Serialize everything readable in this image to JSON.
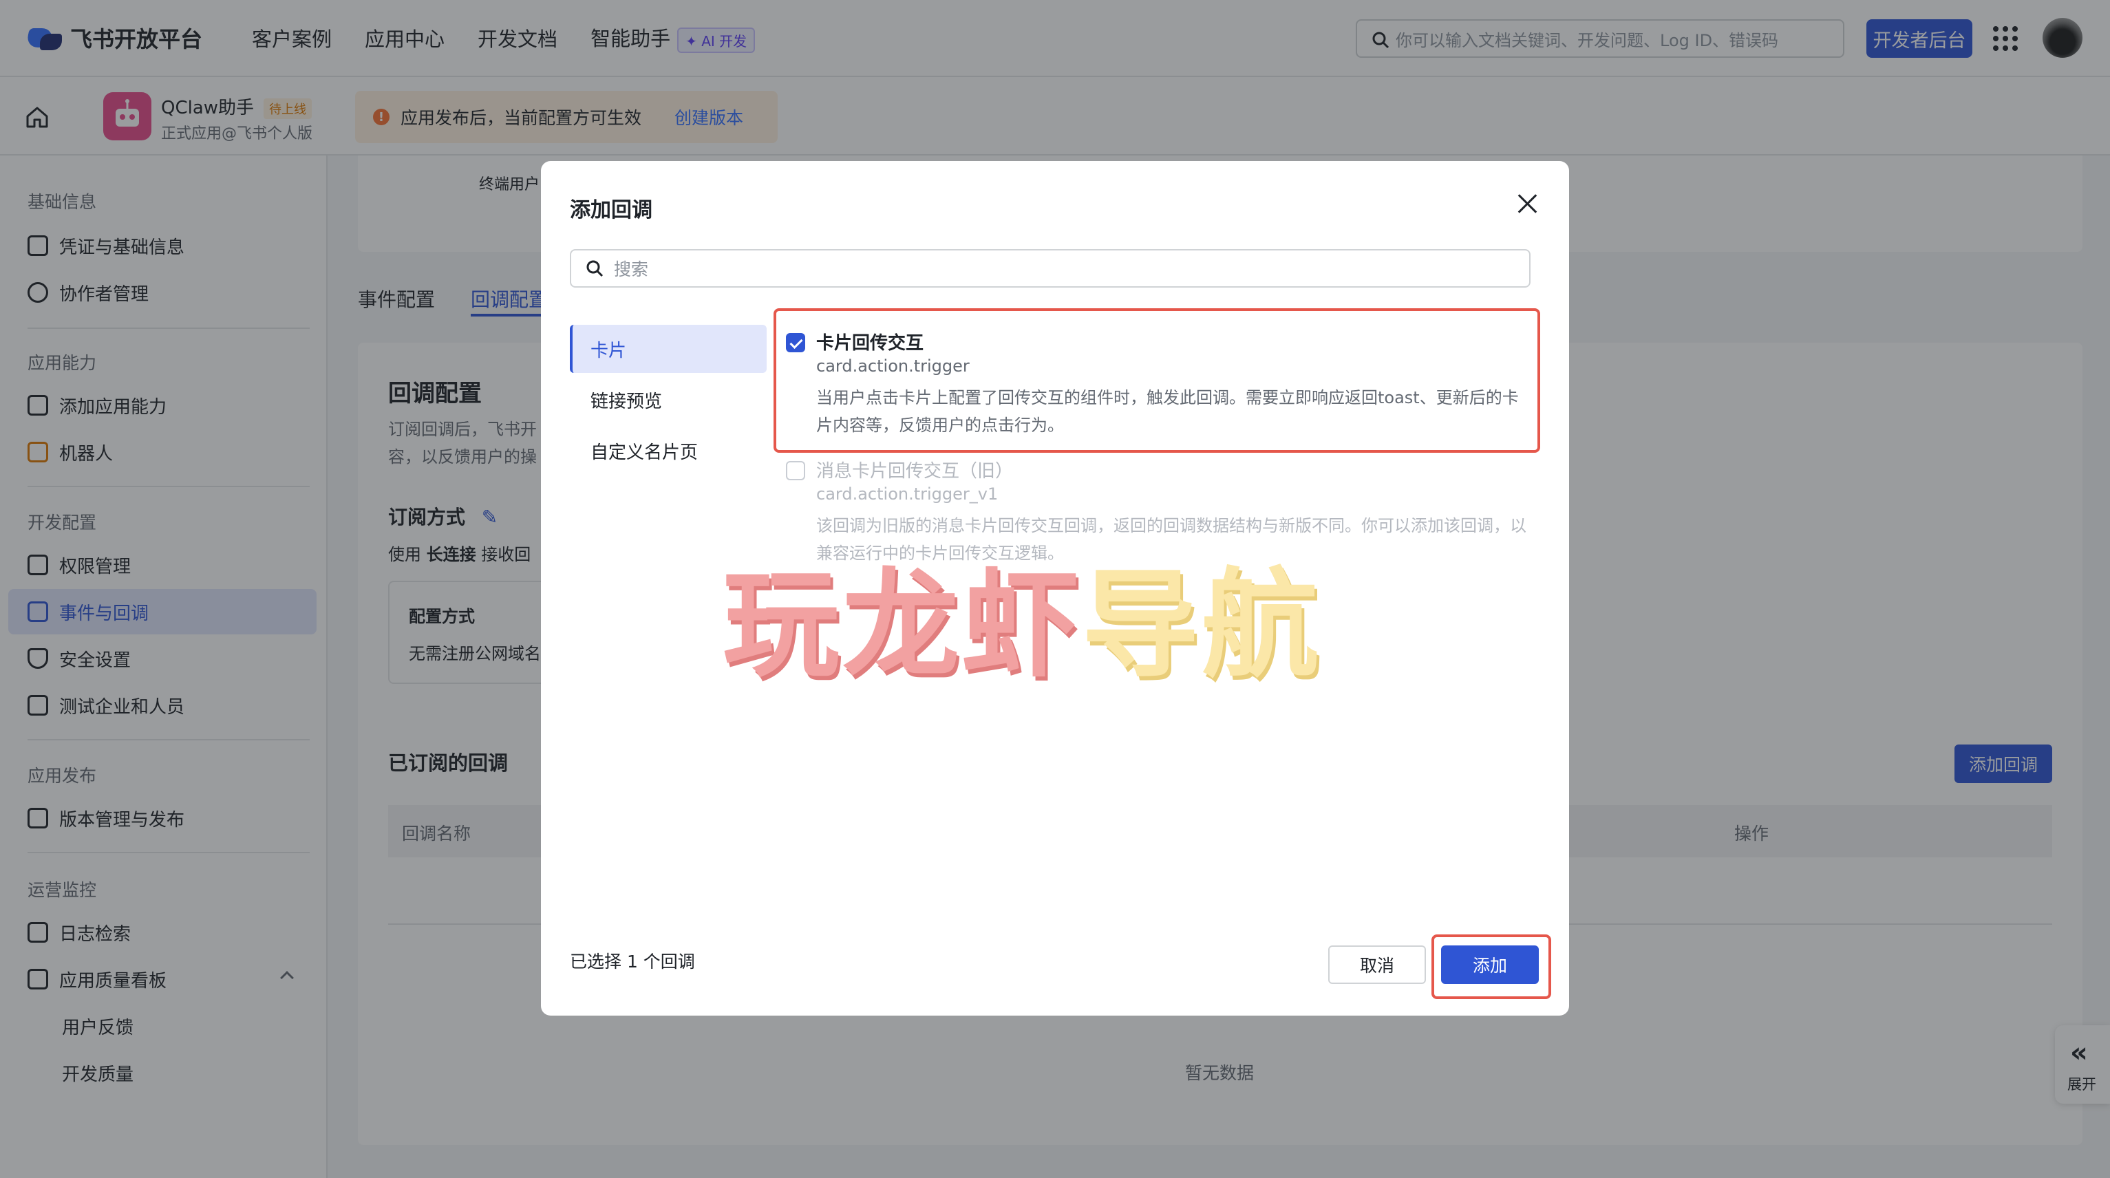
{
  "topbar": {
    "logo_text": "飞书开放平台",
    "nav": [
      "客户案例",
      "应用中心",
      "开发文档",
      "智能助手"
    ],
    "ai_badge": "✦ AI 开发",
    "search_placeholder": "你可以输入文档关键词、开发问题、Log ID、错误码",
    "dev_button": "开发者后台"
  },
  "appbar": {
    "app_name": "QClaw助手",
    "app_status": "待上线",
    "app_sub": "正式应用@飞书个人版",
    "notice_text": "应用发布后，当前配置方可生效",
    "notice_link": "创建版本"
  },
  "sidebar": {
    "groups": [
      "基础信息",
      "应用能力",
      "开发配置",
      "应用发布",
      "运营监控"
    ],
    "items": [
      "凭证与基础信息",
      "协作者管理",
      "添加应用能力",
      "机器人",
      "权限管理",
      "事件与回调",
      "安全设置",
      "测试企业和人员",
      "版本管理与发布",
      "日志检索",
      "应用质量看板",
      "用户反馈",
      "开发质量"
    ]
  },
  "main": {
    "term_user": "终端用户",
    "tabs": [
      "事件配置",
      "回调配置"
    ],
    "title": "回调配置",
    "desc_1": "订阅回调后，飞书开",
    "desc_2": "容，以反馈用户的操",
    "subscribe_title": "订阅方式",
    "subscribe_line_prefix": "使用",
    "subscribe_line_bold": "长连接",
    "subscribe_line_suffix": "接收回",
    "config_heading": "配置方式",
    "config_desc": "无需注册公网域名",
    "subscribed_title": "已订阅的回调",
    "add_callback_button": "添加回调",
    "col_name": "回调名称",
    "col_action": "操作",
    "empty": "暂无数据",
    "expand": "展开"
  },
  "modal": {
    "title": "添加回调",
    "search_placeholder": "搜索",
    "categories": [
      "卡片",
      "链接预览",
      "自定义名片页"
    ],
    "options": [
      {
        "title": "卡片回传交互",
        "key": "card.action.trigger",
        "desc": "当用户点击卡片上配置了回传交互的组件时，触发此回调。需要立即响应返回toast、更新后的卡片内容等，反馈用户的点击行为。",
        "checked": true
      },
      {
        "title": "消息卡片回传交互（旧）",
        "key": "card.action.trigger_v1",
        "desc": "该回调为旧版的消息卡片回传交互回调，返回的回调数据结构与新版不同。你可以添加该回调，以兼容运行中的卡片回传交互逻辑。",
        "checked": false
      }
    ],
    "selected_text": "已选择 1 个回调",
    "cancel": "取消",
    "add": "添加"
  },
  "watermark": {
    "part1": "玩龙虾",
    "part2": "导航"
  },
  "colors": {
    "accent": "#2f55d4",
    "highlight": "#e5574b",
    "notice_bg": "#fff1e0"
  }
}
